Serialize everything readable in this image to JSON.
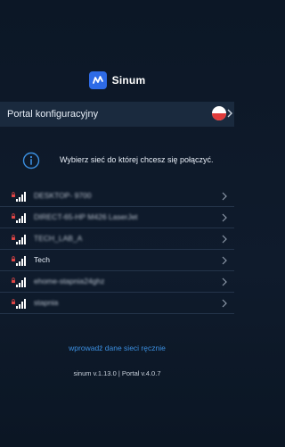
{
  "logo": {
    "icon": "sinum-logo-icon",
    "text": "Sinum"
  },
  "portal": {
    "title": "Portal konfiguracyjny",
    "flag": "poland-flag-icon",
    "flag_colors": [
      "#ffffff",
      "#e03b3b"
    ],
    "chevron": "chevron-right-icon"
  },
  "info": {
    "icon": "info-icon",
    "text": "Wybierz sieć do której chcesz się połączyć."
  },
  "networks": [
    {
      "name": "DESKTOP- 9700",
      "blurred": true,
      "secured": true
    },
    {
      "name": "DIRECT-65-HP M426 LaserJet",
      "blurred": true,
      "secured": true
    },
    {
      "name": "TECH_LAB_A",
      "blurred": true,
      "secured": true
    },
    {
      "name": "Tech",
      "blurred": false,
      "secured": true
    },
    {
      "name": "ehome-stapnia24ghz",
      "blurred": true,
      "secured": true
    },
    {
      "name": "stapnia",
      "blurred": true,
      "secured": true
    }
  ],
  "manual_link": "wprowadź dane sieci ręcznie",
  "version": "sinum v.1.13.0 | Portal v.4.0.7",
  "colors": {
    "background": "#0f1b2c",
    "bar": "#1a2a3e",
    "accent": "#2e6be6",
    "link": "#3b8fe0",
    "lock": "#e04646"
  }
}
